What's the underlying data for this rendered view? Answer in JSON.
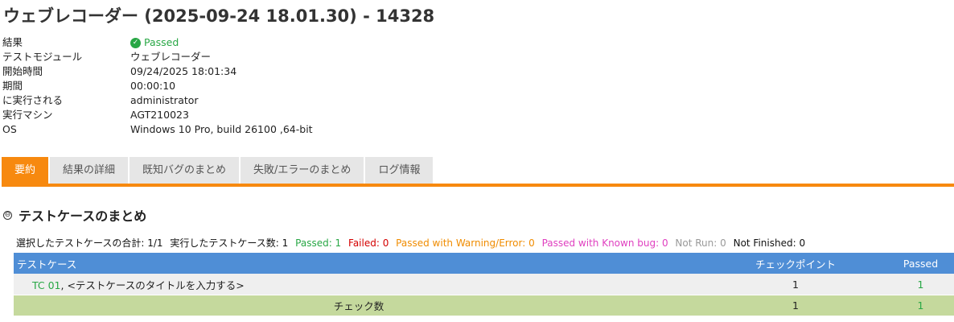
{
  "title": "ウェブレコーダー (2025-09-24 18.01.30) - 14328",
  "info": [
    {
      "label": "結果",
      "value": "Passed",
      "status": "passed"
    },
    {
      "label": "テストモジュール",
      "value": "ウェブレコーダー"
    },
    {
      "label": "開始時間",
      "value": "09/24/2025 18:01:34"
    },
    {
      "label": "期間",
      "value": "00:00:10"
    },
    {
      "label": "に実行される",
      "value": "administrator"
    },
    {
      "label": "実行マシン",
      "value": "AGT210023"
    },
    {
      "label": "OS",
      "value": "Windows 10 Pro, build 26100 ,64-bit"
    }
  ],
  "tabs": [
    {
      "label": "要約",
      "active": true
    },
    {
      "label": "結果の詳細",
      "active": false
    },
    {
      "label": "既知バグのまとめ",
      "active": false
    },
    {
      "label": "失敗/エラーのまとめ",
      "active": false
    },
    {
      "label": "ログ情報",
      "active": false
    }
  ],
  "section": {
    "collapse_glyph": "⊖",
    "title": "テストケースのまとめ"
  },
  "summary": {
    "selected_total": "選択したテストケースの合計: 1/1",
    "executed_count": "実行したテストケース数: 1",
    "passed": "Passed: 1",
    "failed": "Failed: 0",
    "passed_with_warning": "Passed with Warning/Error: 0",
    "passed_with_known_bug": "Passed with Known bug: 0",
    "not_run": "Not Run: 0",
    "not_finished": "Not Finished: 0"
  },
  "table": {
    "headers": [
      "テストケース",
      "チェックポイント",
      "Passed"
    ],
    "rows": [
      {
        "tc_id": "TC 01",
        "tc_title": ", <テストケースのタイトルを入力する>",
        "checkpoints": "1",
        "passed": "1"
      }
    ],
    "total_row": {
      "label": "チェック数",
      "checkpoints": "1",
      "passed": "1"
    }
  },
  "colors": {
    "accent": "#f7890f",
    "header_blue": "#4f8ed6",
    "passed_green": "#28a745",
    "total_row_green": "#c5d99d"
  },
  "icons": {
    "passed": "check-circle-icon",
    "collapse": "collapse-circle-icon"
  }
}
